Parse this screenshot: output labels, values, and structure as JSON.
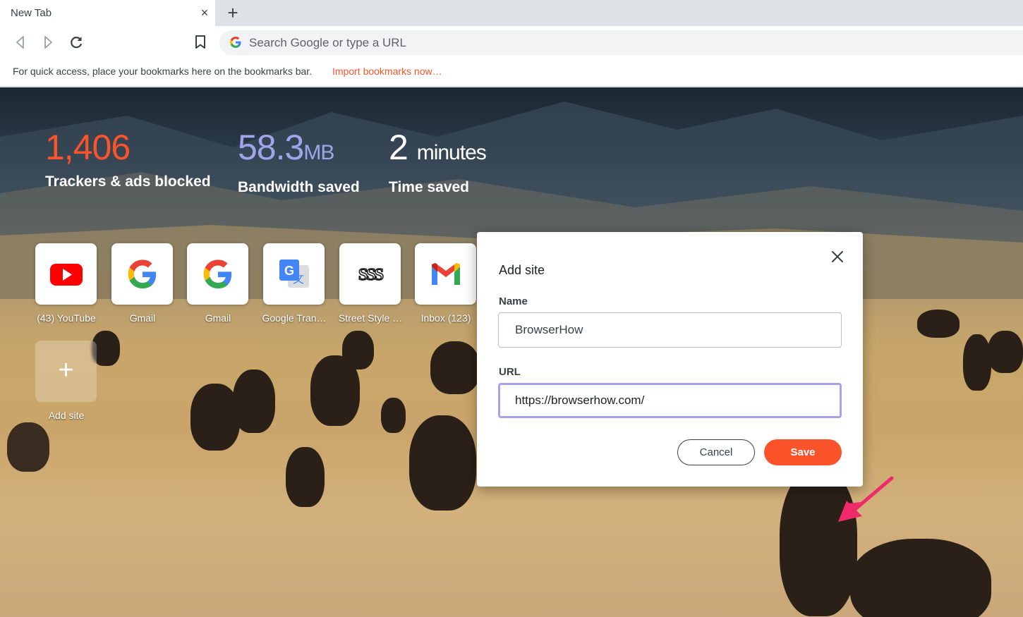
{
  "tab": {
    "title": "New Tab",
    "close_icon": "×",
    "new_tab_icon": "+"
  },
  "omnibox": {
    "placeholder": "Search Google or type a URL"
  },
  "bookmarks_bar": {
    "message": "For quick access, place your bookmarks here on the bookmarks bar.",
    "import_link": "Import bookmarks now…"
  },
  "stats": [
    {
      "value": "1,406",
      "unit": "",
      "label": "Trackers & ads blocked",
      "color": "#fb542b"
    },
    {
      "value": "58.3",
      "unit": "MB",
      "label": "Bandwidth saved",
      "color": "#a0a5eb"
    },
    {
      "value": "2",
      "unit": "minutes",
      "label": "Time saved",
      "color": "#ffffff"
    }
  ],
  "top_sites": [
    {
      "name": "(43) YouTube",
      "icon": "youtube-icon"
    },
    {
      "name": "Gmail",
      "icon": "google-icon"
    },
    {
      "name": "Gmail",
      "icon": "google-icon"
    },
    {
      "name": "Google Tran…",
      "icon": "google-translate-icon"
    },
    {
      "name": "Street Style …",
      "icon": "sss-icon"
    },
    {
      "name": "Inbox (123)",
      "icon": "gmail-icon"
    }
  ],
  "add_site_tile": {
    "label": "Add site",
    "icon": "+"
  },
  "modal": {
    "title": "Add site",
    "name_label": "Name",
    "name_value": "BrowserHow",
    "url_label": "URL",
    "url_value": "https://browserhow.com/",
    "cancel_label": "Cancel",
    "save_label": "Save"
  },
  "colors": {
    "accent": "#fb542b",
    "focus_ring": "#a6a3ec",
    "annotation_arrow": "#ee2a6b"
  }
}
